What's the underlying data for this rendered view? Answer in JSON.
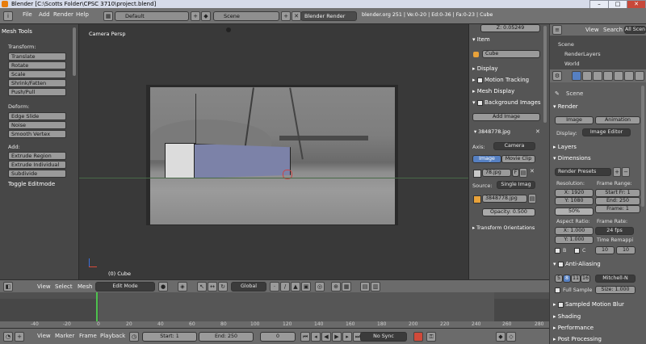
{
  "window": {
    "title": "Blender [C:\\Scotts Folder\\CPSC 3710\\project.blend]",
    "min": "–",
    "max": "□",
    "close": "✕"
  },
  "topbar": {
    "menus": [
      "File",
      "Add",
      "Render",
      "Help"
    ],
    "layout": "Default",
    "scene": "Scene",
    "engine": "Blender Render",
    "stats": "blender.org 251 | Ve:0-20 | Ed:0-36 | Fa:0-23 | Cube"
  },
  "toolshelf": {
    "title": "Mesh Tools",
    "transform_label": "Transform:",
    "transform": [
      "Translate",
      "Rotate",
      "Scale",
      "Shrink/Fatten",
      "Push/Pull"
    ],
    "deform_label": "Deform:",
    "deform": [
      "Edge Slide",
      "Noise",
      "Smooth Vertex"
    ],
    "add_label": "Add:",
    "add": [
      "Extrude Region",
      "Extrude Individual",
      "Subdivide"
    ],
    "footer": "Toggle Editmode"
  },
  "viewport": {
    "view_name": "Camera Persp",
    "object_name": "(0) Cube"
  },
  "npanel": {
    "top_value": "Z: 0.05249",
    "item_label": "Item",
    "item_name": "Cube",
    "sections": [
      "Display",
      "Motion Tracking",
      "Mesh Display",
      "Background Images"
    ],
    "add_image": "Add Image",
    "image_entry": "3848778.jpg",
    "axis_label": "Axis:",
    "axis_value": "Camera",
    "tab_image": "Image",
    "tab_clip": "Movie Clip",
    "file": "78.jpg",
    "file_users": "F",
    "source_label": "Source:",
    "source_value": "Single Imag",
    "path": "3848778.jpg",
    "opacity": "Opacity: 0.500",
    "footer": "Transform Orientations"
  },
  "vpheader": {
    "menus": [
      "View",
      "Select",
      "Mesh"
    ],
    "mode": "Edit Mode",
    "orientation": "Global"
  },
  "timeline": {
    "ticks": [
      "-40",
      "-20",
      "0",
      "20",
      "40",
      "60",
      "80",
      "100",
      "120",
      "140",
      "160",
      "180",
      "200",
      "220",
      "240",
      "260",
      "280"
    ],
    "menus": [
      "View",
      "Marker",
      "Frame",
      "Playback"
    ],
    "start": "Start: 1",
    "end": "End: 250",
    "current": "0",
    "sync": "No Sync"
  },
  "outliner": {
    "menus": [
      "View",
      "Search"
    ],
    "filter": "All Scenes",
    "items": [
      "Scene",
      "RenderLayers",
      "World"
    ]
  },
  "props": {
    "scene": "Scene",
    "render_label": "Render",
    "image_btn": "Image",
    "animation_btn": "Animation",
    "display_label": "Display:",
    "display_value": "Image Editor",
    "layers": "Layers",
    "dimensions": "Dimensions",
    "presets": "Render Presets",
    "resolution_label": "Resolution:",
    "res_x": "X: 1920",
    "res_y": "Y: 1080",
    "res_pct": "50%",
    "frame_range_label": "Frame Range:",
    "start": "Start Fr: 1",
    "end": "End: 250",
    "frame": "Frame: 1",
    "aspect_label": "Aspect Ratio:",
    "asp_x": "X: 1.000",
    "asp_y": "Y: 1.000",
    "frame_rate_label": "Frame Rate:",
    "fps": "24 fps",
    "time_remap": "Time Remappi",
    "b_label": "B",
    "c_label": "C",
    "remap_old": "10",
    "remap_new": "10",
    "aa_label": "Anti-Aliasing",
    "aa_samples": [
      "5",
      "8",
      "11",
      "16"
    ],
    "aa_filter": "Mitchell-N",
    "full_sample": "Full Sample",
    "size": "Size: 1.000",
    "sampled_motion_blur": "Sampled Motion Blur",
    "shading": "Shading",
    "performance": "Performance",
    "post_processing": "Post Processing"
  }
}
